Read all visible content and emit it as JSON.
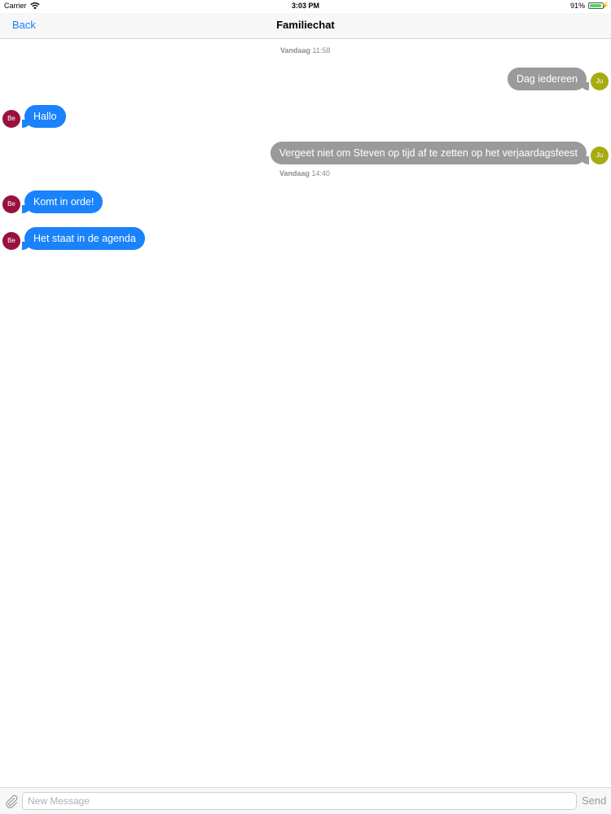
{
  "status_bar": {
    "carrier": "Carrier",
    "time": "3:03 PM",
    "battery": "91%",
    "battery_level": 0.91,
    "wifi_icon": "wifi-icon",
    "charging_icon": "charging-icon"
  },
  "nav": {
    "back_label": "Back",
    "title": "Familiechat"
  },
  "timestamps": [
    {
      "day": "Vandaag",
      "time": "11:58"
    },
    {
      "day": "Vandaag",
      "time": "14:40"
    }
  ],
  "messages": [
    {
      "sender": "Ju",
      "direction": "outgoing",
      "text": "Dag iedereen"
    },
    {
      "sender": "Be",
      "direction": "incoming",
      "text": "Hallo"
    },
    {
      "sender": "Ju",
      "direction": "outgoing",
      "text": "Vergeet niet om Steven op tijd af te zetten op het verjaardagsfeest"
    },
    {
      "sender": "Be",
      "direction": "incoming",
      "text": "Komt in orde!"
    },
    {
      "sender": "Be",
      "direction": "incoming",
      "text": "Het staat in de agenda"
    }
  ],
  "input": {
    "placeholder": "New Message",
    "send_label": "Send",
    "attach_icon": "paperclip-icon"
  },
  "colors": {
    "incoming_bubble": "#1a82fb",
    "outgoing_bubble": "#9a9a9a",
    "avatar_be": "#98113f",
    "avatar_ju": "#a6ac0f",
    "accent": "#147efb"
  }
}
